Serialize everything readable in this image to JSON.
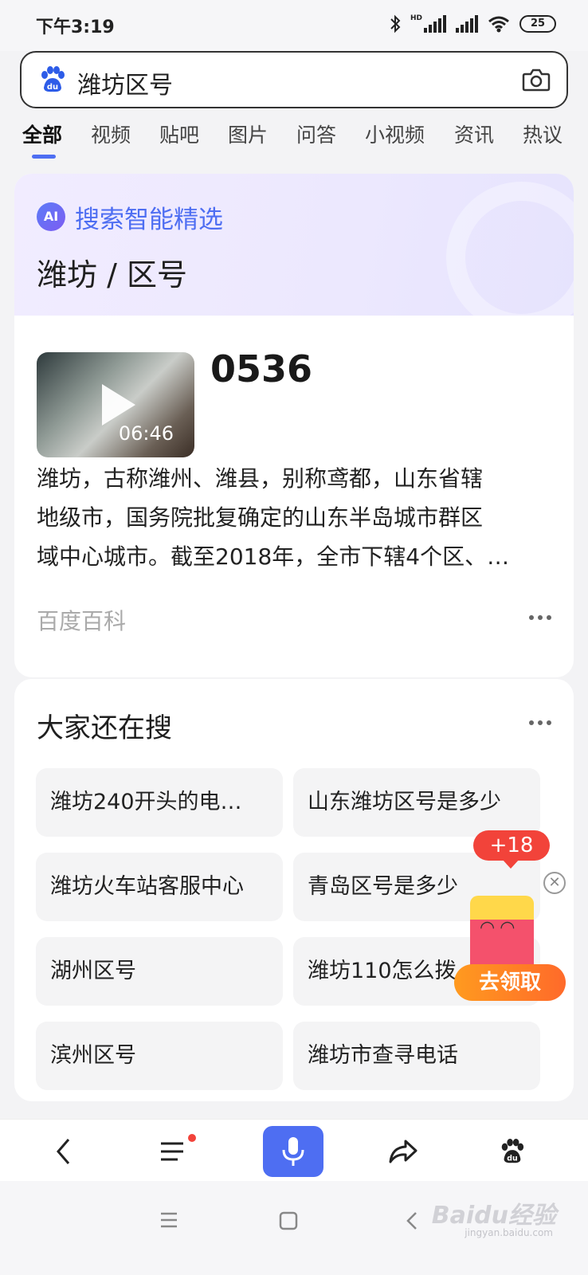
{
  "status_bar": {
    "time": "下午3:19",
    "hd_label": "HD",
    "battery": "25"
  },
  "search": {
    "query": "潍坊区号"
  },
  "tabs": [
    {
      "label": "全部",
      "active": true
    },
    {
      "label": "视频"
    },
    {
      "label": "贴吧"
    },
    {
      "label": "图片"
    },
    {
      "label": "问答"
    },
    {
      "label": "小视频"
    },
    {
      "label": "资讯"
    },
    {
      "label": "热议"
    }
  ],
  "ai_card": {
    "badge": "AI",
    "title": "搜索智能精选",
    "subtitle": "潍坊 / 区号",
    "video_duration": "06:46",
    "answer": "0536",
    "description_lines": [
      "潍坊，古称潍州、潍县，别称鸢都，山东省辖",
      "地级市，国务院批复确定的山东半岛城市群区",
      "域中心城市。截至2018年，全市下辖4个区、…"
    ],
    "source": "百度百科"
  },
  "related": {
    "title": "大家还在搜",
    "items": [
      "潍坊240开头的电…",
      "山东潍坊区号是多少",
      "潍坊火车站客服中心",
      "青岛区号是多少",
      "湖州区号",
      "潍坊110怎么拨",
      "滨州区号",
      "潍坊市查寻电话"
    ]
  },
  "promo": {
    "badge": "+18",
    "button": "去领取"
  },
  "watermark": {
    "text": "Baidu经验",
    "sub": "jingyan.baidu.com"
  },
  "colors": {
    "accent": "#4e6ef2",
    "red": "#f2433a",
    "orange": "#ff7a23"
  }
}
